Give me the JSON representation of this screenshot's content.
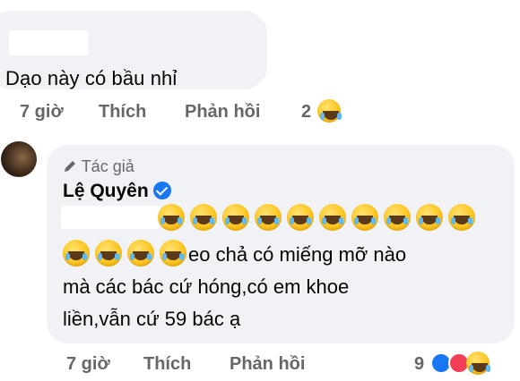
{
  "top_comment": {
    "text": "Dạo này có bầu  nhỉ",
    "actions": {
      "time": "7 giờ",
      "like": "Thích",
      "reply": "Phản hồi",
      "reaction_count": "2"
    }
  },
  "reply": {
    "author_badge": "Tác giả",
    "name": "Lệ Quyên",
    "lines": [
      "eo chả có miếng mỡ nào",
      "mà các bác cứ hóng,có em khoe",
      "liền,vẫn cứ 59 bác ạ"
    ],
    "actions": {
      "time": "7 giờ",
      "like": "Thích",
      "reply": "Phản hồi",
      "reaction_count": "9"
    }
  },
  "icons": {
    "pencil": "pencil-icon",
    "verified": "verified-badge-icon",
    "laugh": "laugh-emoji",
    "like": "like-reaction-icon",
    "love": "love-reaction-icon"
  },
  "colors": {
    "bubble": "#f0f2f5",
    "muted": "#65676b",
    "brand": "#1877f2",
    "love": "#f33e58"
  }
}
